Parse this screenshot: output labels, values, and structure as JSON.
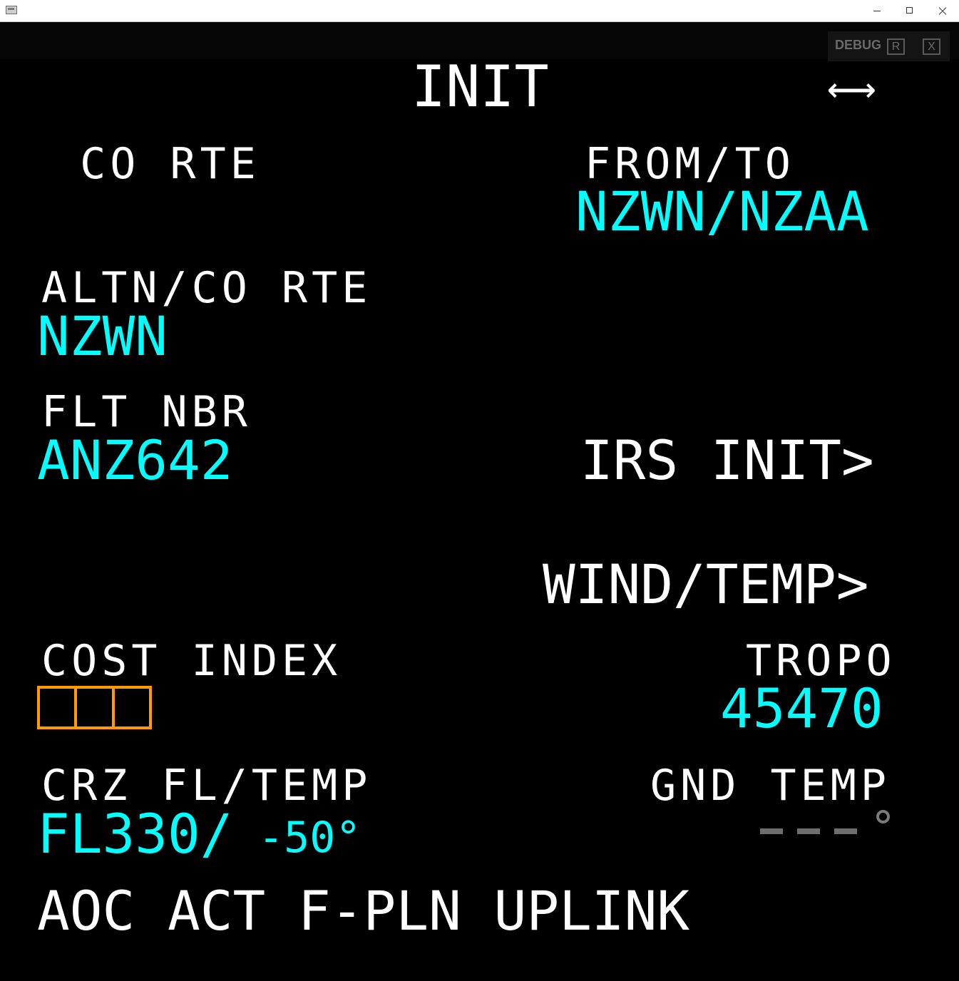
{
  "window": {
    "icon": "app-window-icon",
    "controls": [
      "minimize-icon",
      "maximize-icon",
      "close-icon"
    ]
  },
  "debug": {
    "label": "DEBUG",
    "reload": "R",
    "close": "X"
  },
  "page": {
    "title": "INIT",
    "slew_arrows": "←→"
  },
  "left": {
    "co_rte_label": " CO RTE",
    "altn_label": "ALTN/CO RTE",
    "altn_value": "NZWN",
    "flt_nbr_label": "FLT NBR",
    "flt_nbr_value": "ANZ642",
    "cost_index_label": "COST INDEX",
    "crz_label": "CRZ FL/TEMP",
    "crz_fl": "FL330/",
    "crz_temp": "-50°",
    "aoc_prompt": "AOC ACT F-PLN UPLINK"
  },
  "right": {
    "from_to_label": "FROM/TO",
    "from_to_value": "NZWN/NZAA",
    "irs_init": "IRS INIT>",
    "wind_temp": "WIND/TEMP>",
    "tropo_label": "TROPO",
    "tropo_value": "45470",
    "gnd_temp_label": "GND TEMP"
  },
  "colors": {
    "background": "#000000",
    "label": "#ffffff",
    "data": "#00ffff",
    "amber": "#ff9a00",
    "inactive": "#6e6e6e"
  }
}
